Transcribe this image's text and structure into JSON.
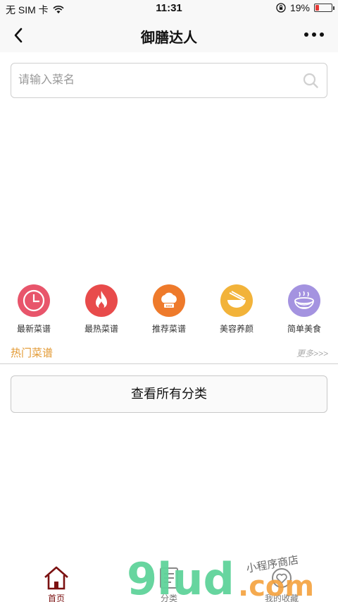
{
  "status": {
    "carrier": "无 SIM 卡",
    "time": "11:31",
    "battery": "19%",
    "battery_level": 0.19
  },
  "nav": {
    "title": "御膳达人"
  },
  "search": {
    "placeholder": "请输入菜名"
  },
  "categories": [
    {
      "label": "最新菜谱",
      "icon": "clock-icon",
      "color": "#e8556b"
    },
    {
      "label": "最热菜谱",
      "icon": "fire-icon",
      "color": "#e84b4b"
    },
    {
      "label": "推荐菜谱",
      "icon": "chef-hat-icon",
      "color": "#ee7a2b"
    },
    {
      "label": "美容养颜",
      "icon": "bowl-icon",
      "color": "#f2b33a"
    },
    {
      "label": "简单美食",
      "icon": "noodle-bowl-icon",
      "color": "#a493e0"
    }
  ],
  "hot": {
    "title": "热门菜谱",
    "more": "更多>>>"
  },
  "all_button": "查看所有分类",
  "tabs": [
    {
      "label": "首页",
      "icon": "home-icon",
      "active": true
    },
    {
      "label": "分类",
      "icon": "category-icon",
      "active": false
    },
    {
      "label": "我的收藏",
      "icon": "favorite-icon",
      "active": false
    }
  ],
  "watermark": {
    "brand": "9lud.com",
    "slogan": "小程序商店",
    "brand_color": "#5fd39a",
    "accent_color": "#f5a13d"
  },
  "colors": {
    "accent": "#7b1111",
    "hot_title": "#e39a34"
  }
}
